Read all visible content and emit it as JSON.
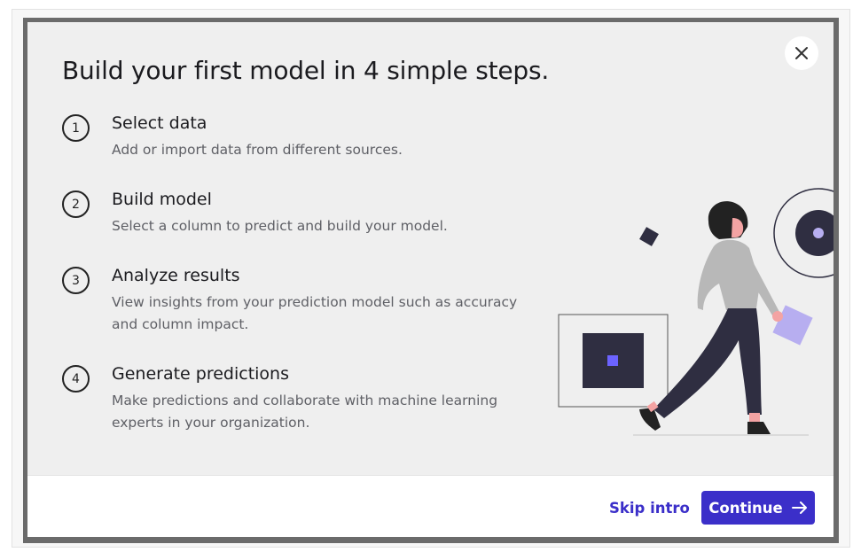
{
  "dialog": {
    "title": "Build your first model in 4 simple steps.",
    "close_icon": "close-icon"
  },
  "steps": [
    {
      "number": "1",
      "title": "Select data",
      "description": "Add or import data from different sources."
    },
    {
      "number": "2",
      "title": "Build model",
      "description": "Select a column to predict and build your model."
    },
    {
      "number": "3",
      "title": "Analyze results",
      "description": "View insights from your prediction model such as accuracy and column impact."
    },
    {
      "number": "4",
      "title": "Generate predictions",
      "description": "Make predictions and collaborate with machine learning experts in your organization."
    }
  ],
  "footer": {
    "skip_label": "Skip intro",
    "continue_label": "Continue",
    "continue_icon": "arrow-right-icon"
  },
  "colors": {
    "accent": "#3b2fc9",
    "dialog_bg": "#efefef",
    "illustration_dark": "#2f2e41",
    "illustration_accent": "#6c63ff"
  }
}
